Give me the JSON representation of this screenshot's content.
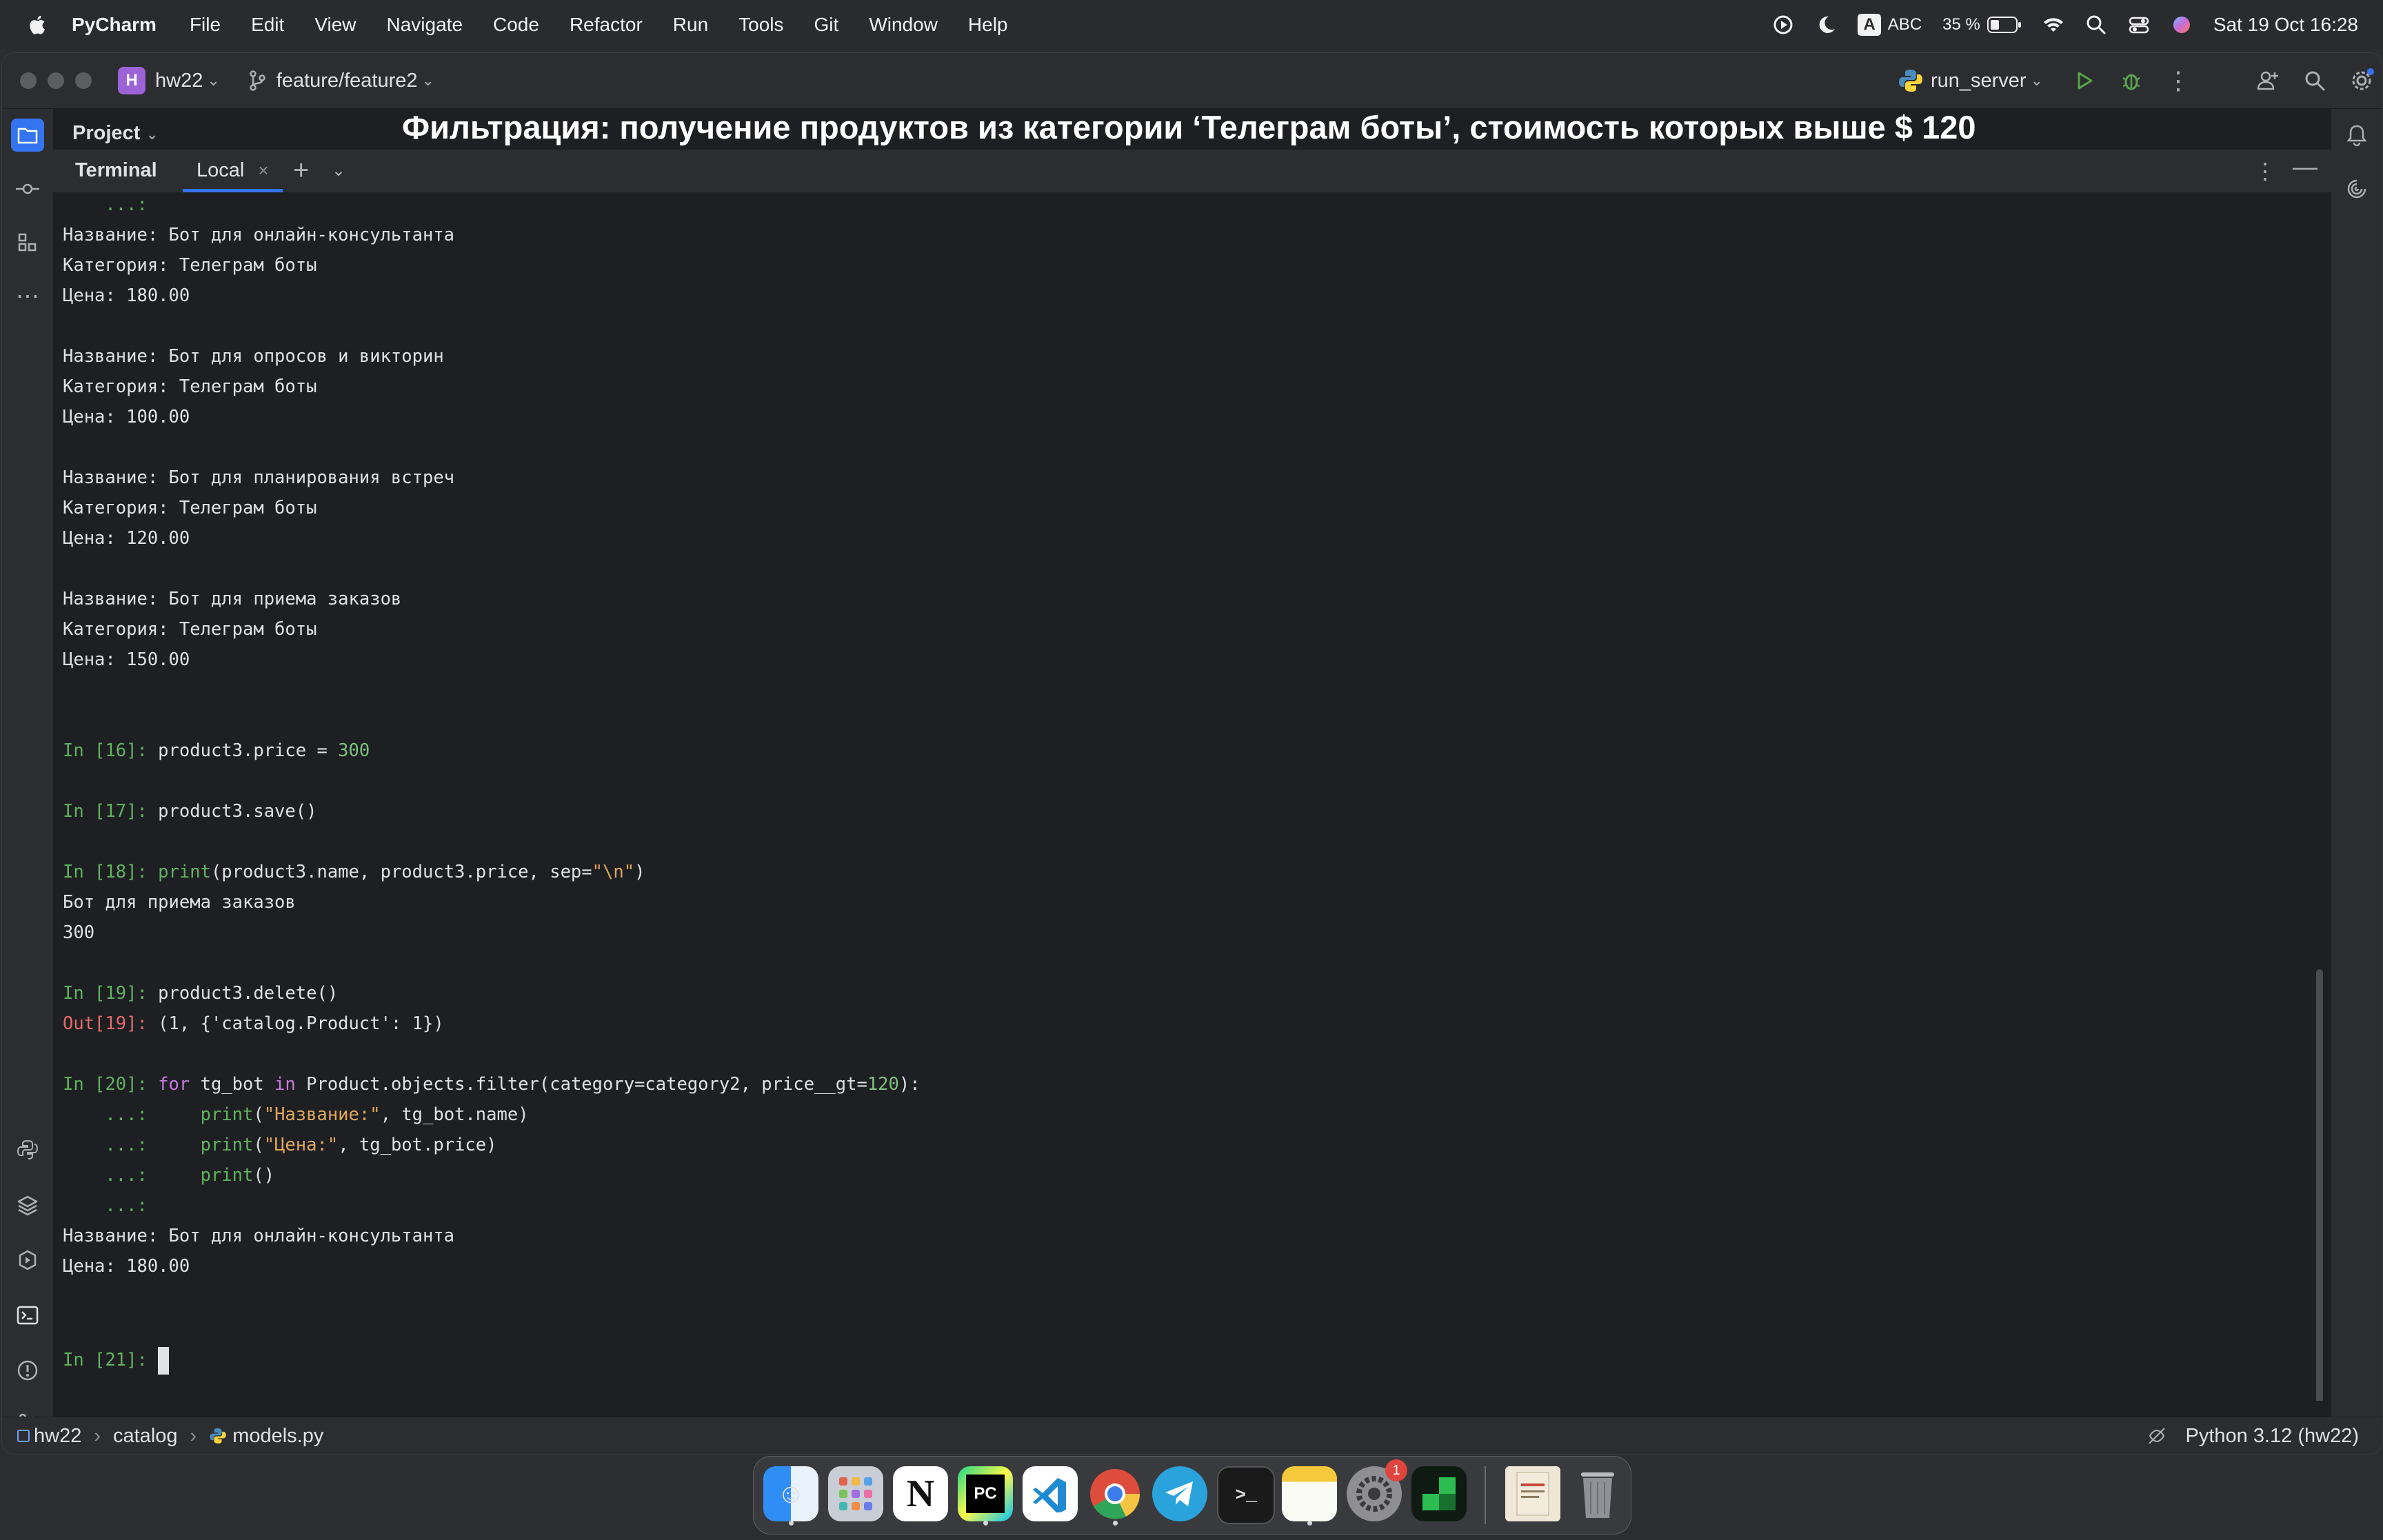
{
  "menubar": {
    "app_name": "PyCharm",
    "items": [
      "File",
      "Edit",
      "View",
      "Navigate",
      "Code",
      "Refactor",
      "Run",
      "Tools",
      "Git",
      "Window",
      "Help"
    ],
    "input_source_badge": "A",
    "input_source": "ABC",
    "battery": "35 %",
    "clock": "Sat 19 Oct  16:28"
  },
  "titlebar": {
    "project_badge": "H",
    "project": "hw22",
    "branch": "feature/feature2",
    "run_config": "run_server"
  },
  "project_panel": {
    "title": "Project"
  },
  "caption": "Фильтрация: получение продуктов из категории ‘Телеграм боты’, стоимость которых выше $ 120",
  "terminal": {
    "title": "Terminal",
    "tab_label": "Local",
    "lines": {
      "l0": "    ...:",
      "l1": "Название: Бот для онлайн-консультанта",
      "l2": "Категория: Телеграм боты",
      "l3": "Цена: 180.00",
      "l4": "Название: Бот для опросов и викторин",
      "l5": "Категория: Телеграм боты",
      "l6": "Цена: 100.00",
      "l7": "Название: Бот для планирования встреч",
      "l8": "Категория: Телеграм боты",
      "l9": "Цена: 120.00",
      "l10": "Название: Бот для приема заказов",
      "l11": "Категория: Телеграм боты",
      "l12": "Цена: 150.00",
      "in16_prompt": "In [16]:",
      "in16_code": " product3.price = ",
      "in16_num": "300",
      "in17_prompt": "In [17]:",
      "in17_code": " product3.save()",
      "in18_prompt": "In [18]:",
      "in18_fn": " print",
      "in18_args": "(product3.name, product3.price, sep=",
      "in18_str": "\"\\n\"",
      "in18_end": ")",
      "out18a": "Бот для приема заказов",
      "out18b": "300",
      "in19_prompt": "In [19]:",
      "in19_code": " product3.delete()",
      "out19_prompt": "Out[19]:",
      "out19_value": " (1, {'catalog.Product': 1})",
      "in20_prompt": "In [20]:",
      "in20_for": " for",
      "in20_var": " tg_bot ",
      "in20_in": "in",
      "in20_expr": " Product.objects.filter(category=category2, price__gt=",
      "in20_num": "120",
      "in20_end": "):",
      "c1_prompt": "    ...:",
      "c1_fn": "     print",
      "c1_open": "(",
      "c1_str": "\"Название:\"",
      "c1_rest": ", tg_bot.name)",
      "c2_prompt": "    ...:",
      "c2_fn": "     print",
      "c2_open": "(",
      "c2_str": "\"Цена:\"",
      "c2_rest": ", tg_bot.price)",
      "c3_prompt": "    ...:",
      "c3_fn": "     print",
      "c3_rest": "()",
      "c4_prompt": "    ...:",
      "out20a": "Название: Бот для онлайн-консультанта",
      "out20b": "Цена: 180.00",
      "in21_prompt": "In [21]:"
    }
  },
  "statusbar": {
    "breadcrumb": [
      "hw22",
      "catalog",
      "models.py"
    ],
    "interpreter": "Python 3.12 (hw22)"
  },
  "dock": {
    "notification_badge": "1",
    "apps": [
      "finder-icon",
      "launchpad-icon",
      "notion-icon",
      "pycharm-icon",
      "vscode-icon",
      "chrome-icon",
      "telegram-icon",
      "terminal-icon",
      "notes-icon",
      "system-settings-icon",
      "app-icon",
      "book-icon",
      "trash-icon"
    ]
  }
}
